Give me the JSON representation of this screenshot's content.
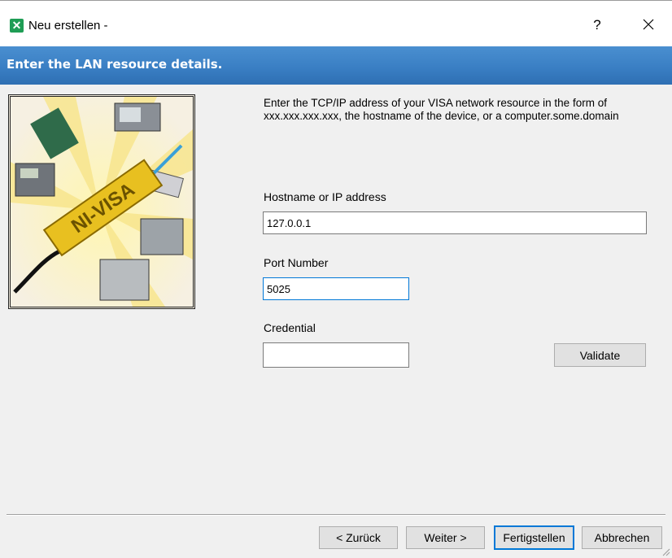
{
  "window": {
    "title": "Neu erstellen -",
    "app_icon": "ni-max-icon",
    "help_label": "?",
    "close_icon": "close-icon"
  },
  "banner": {
    "text": "Enter the LAN resource details.",
    "color": "#3a7fc4"
  },
  "image": {
    "logo_text": "NI-VISA"
  },
  "form": {
    "description": "Enter the TCP/IP address of your VISA network resource in the form of xxx.xxx.xxx.xxx, the hostname of the device, or a computer.some.domain",
    "hostname_label": "Hostname or IP address",
    "hostname_value": "127.0.0.1",
    "port_label": "Port Number",
    "port_value": "5025",
    "credential_label": "Credential",
    "credential_value": "",
    "validate_label": "Validate"
  },
  "footer": {
    "back_label": "< Zurück",
    "next_label": "Weiter >",
    "finish_label": "Fertigstellen",
    "cancel_label": "Abbrechen"
  },
  "colors": {
    "focus_border": "#0078d7",
    "logo_yellow": "#e8c020"
  }
}
